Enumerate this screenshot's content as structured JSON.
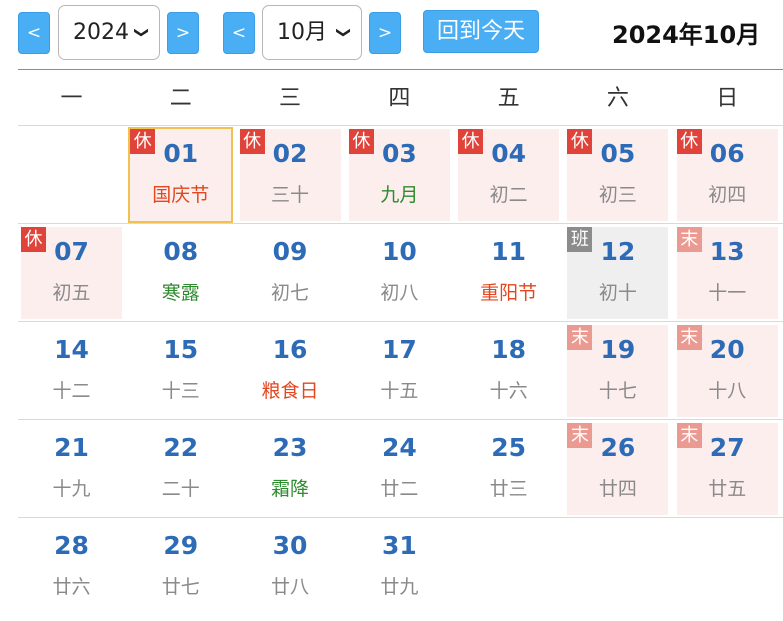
{
  "toolbar": {
    "prev_year": "<",
    "next_year": ">",
    "year_value": "2024",
    "prev_month": "<",
    "next_month": ">",
    "month_value": "10月",
    "today_button": "回到今天",
    "current_title": "2024年10月"
  },
  "weekdays": [
    "一",
    "二",
    "三",
    "四",
    "五",
    "六",
    "日"
  ],
  "weeks": [
    [
      null,
      {
        "day": "01",
        "lunar": "国庆节",
        "lunar_type": "festival",
        "badge": "休",
        "badge_type": "rest",
        "style": "today"
      },
      {
        "day": "02",
        "lunar": "三十",
        "lunar_type": "normal",
        "badge": "休",
        "badge_type": "rest",
        "style": "holiday"
      },
      {
        "day": "03",
        "lunar": "九月",
        "lunar_type": "term",
        "badge": "休",
        "badge_type": "rest",
        "style": "holiday"
      },
      {
        "day": "04",
        "lunar": "初二",
        "lunar_type": "normal",
        "badge": "休",
        "badge_type": "rest",
        "style": "holiday"
      },
      {
        "day": "05",
        "lunar": "初三",
        "lunar_type": "normal",
        "badge": "休",
        "badge_type": "rest",
        "style": "holiday"
      },
      {
        "day": "06",
        "lunar": "初四",
        "lunar_type": "normal",
        "badge": "休",
        "badge_type": "rest",
        "style": "holiday"
      }
    ],
    [
      {
        "day": "07",
        "lunar": "初五",
        "lunar_type": "normal",
        "badge": "休",
        "badge_type": "rest",
        "style": "holiday"
      },
      {
        "day": "08",
        "lunar": "寒露",
        "lunar_type": "term",
        "badge": null,
        "badge_type": null,
        "style": "normal"
      },
      {
        "day": "09",
        "lunar": "初七",
        "lunar_type": "normal",
        "badge": null,
        "badge_type": null,
        "style": "normal"
      },
      {
        "day": "10",
        "lunar": "初八",
        "lunar_type": "normal",
        "badge": null,
        "badge_type": null,
        "style": "normal"
      },
      {
        "day": "11",
        "lunar": "重阳节",
        "lunar_type": "festival",
        "badge": null,
        "badge_type": null,
        "style": "normal"
      },
      {
        "day": "12",
        "lunar": "初十",
        "lunar_type": "normal",
        "badge": "班",
        "badge_type": "work",
        "style": "workday"
      },
      {
        "day": "13",
        "lunar": "十一",
        "lunar_type": "normal",
        "badge": "末",
        "badge_type": "wknd",
        "style": "weekend"
      }
    ],
    [
      {
        "day": "14",
        "lunar": "十二",
        "lunar_type": "normal",
        "badge": null,
        "badge_type": null,
        "style": "normal"
      },
      {
        "day": "15",
        "lunar": "十三",
        "lunar_type": "normal",
        "badge": null,
        "badge_type": null,
        "style": "normal"
      },
      {
        "day": "16",
        "lunar": "粮食日",
        "lunar_type": "festival",
        "badge": null,
        "badge_type": null,
        "style": "normal"
      },
      {
        "day": "17",
        "lunar": "十五",
        "lunar_type": "normal",
        "badge": null,
        "badge_type": null,
        "style": "normal"
      },
      {
        "day": "18",
        "lunar": "十六",
        "lunar_type": "normal",
        "badge": null,
        "badge_type": null,
        "style": "normal"
      },
      {
        "day": "19",
        "lunar": "十七",
        "lunar_type": "normal",
        "badge": "末",
        "badge_type": "wknd",
        "style": "weekend"
      },
      {
        "day": "20",
        "lunar": "十八",
        "lunar_type": "normal",
        "badge": "末",
        "badge_type": "wknd",
        "style": "weekend"
      }
    ],
    [
      {
        "day": "21",
        "lunar": "十九",
        "lunar_type": "normal",
        "badge": null,
        "badge_type": null,
        "style": "normal"
      },
      {
        "day": "22",
        "lunar": "二十",
        "lunar_type": "normal",
        "badge": null,
        "badge_type": null,
        "style": "normal"
      },
      {
        "day": "23",
        "lunar": "霜降",
        "lunar_type": "term",
        "badge": null,
        "badge_type": null,
        "style": "normal"
      },
      {
        "day": "24",
        "lunar": "廿二",
        "lunar_type": "normal",
        "badge": null,
        "badge_type": null,
        "style": "normal"
      },
      {
        "day": "25",
        "lunar": "廿三",
        "lunar_type": "normal",
        "badge": null,
        "badge_type": null,
        "style": "normal"
      },
      {
        "day": "26",
        "lunar": "廿四",
        "lunar_type": "normal",
        "badge": "末",
        "badge_type": "wknd",
        "style": "weekend"
      },
      {
        "day": "27",
        "lunar": "廿五",
        "lunar_type": "normal",
        "badge": "末",
        "badge_type": "wknd",
        "style": "weekend"
      }
    ],
    [
      {
        "day": "28",
        "lunar": "廿六",
        "lunar_type": "normal",
        "badge": null,
        "badge_type": null,
        "style": "normal"
      },
      {
        "day": "29",
        "lunar": "廿七",
        "lunar_type": "normal",
        "badge": null,
        "badge_type": null,
        "style": "normal"
      },
      {
        "day": "30",
        "lunar": "廿八",
        "lunar_type": "normal",
        "badge": null,
        "badge_type": null,
        "style": "normal"
      },
      {
        "day": "31",
        "lunar": "廿九",
        "lunar_type": "normal",
        "badge": null,
        "badge_type": null,
        "style": "normal"
      },
      null,
      null,
      null
    ]
  ],
  "colors": {
    "accent": "#4aaef4",
    "day_number": "#2e6bb6",
    "holiday_bg": "#fdeeee",
    "rest_badge": "#e0433a",
    "work_badge": "#8c8c8c",
    "weekend_badge": "#eb9a92",
    "festival_text": "#e2471f",
    "solar_term_text": "#2e8b2e",
    "today_border": "#f0c24f"
  }
}
